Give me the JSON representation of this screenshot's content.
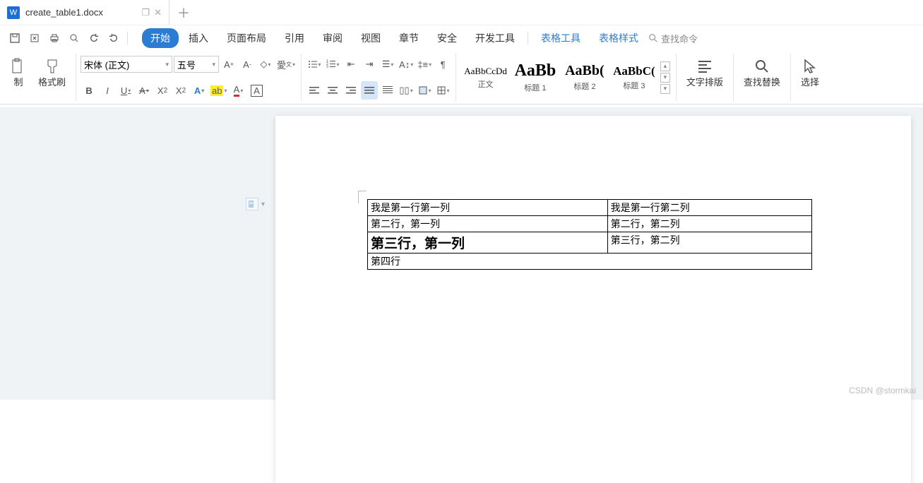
{
  "tab": {
    "title": "create_table1.docx",
    "icon_letter": "W"
  },
  "menubar": [
    "开始",
    "插入",
    "页面布局",
    "引用",
    "审阅",
    "视图",
    "章节",
    "安全",
    "开发工具"
  ],
  "menubar_extra": [
    "表格工具",
    "表格样式"
  ],
  "search_placeholder": "查找命令",
  "clipboard": {
    "paste": "制",
    "brush": "格式刷"
  },
  "font": {
    "family": "宋体 (正文)",
    "size": "五号"
  },
  "format_labels": {
    "bold": "B",
    "italic": "I",
    "underline": "U",
    "strike": "A",
    "sup": "X²",
    "sub": "X₂"
  },
  "styles": [
    {
      "preview": "AaBbCcDd",
      "label": "正文",
      "size": "13px",
      "weight": "normal"
    },
    {
      "preview": "AaBb",
      "label": "标题 1",
      "size": "24px",
      "weight": "bold"
    },
    {
      "preview": "AaBb(",
      "label": "标题 2",
      "size": "20px",
      "weight": "bold"
    },
    {
      "preview": "AaBbC(",
      "label": "标题 3",
      "size": "17px",
      "weight": "bold"
    }
  ],
  "right_tools": {
    "typeset": "文字排版",
    "findrep": "查找替换",
    "select": "选择"
  },
  "table": {
    "rows": [
      {
        "cells": [
          "我是第一行第一列",
          "我是第一行第二列"
        ]
      },
      {
        "cells": [
          "第二行，第一列",
          "第二行，第二列"
        ]
      },
      {
        "cells": [
          "第三行，第一列",
          "第三行，第二列"
        ],
        "bold_first": true
      },
      {
        "cells": [
          "第四行"
        ],
        "colspan": 2
      }
    ]
  },
  "watermark": "CSDN @stormkai"
}
